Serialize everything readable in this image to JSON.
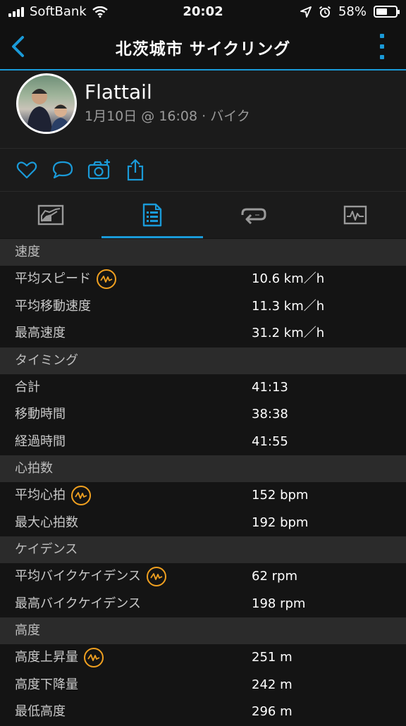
{
  "status_bar": {
    "carrier": "SoftBank",
    "time": "20:02",
    "battery": "58%",
    "battery_level": 0.58
  },
  "nav": {
    "title": "北茨城市 サイクリング"
  },
  "profile": {
    "name": "Flattail",
    "meta": "1月10日 @ 16:08 · バイク"
  },
  "colors": {
    "accent": "#1a9ad8",
    "badge": "#f0a020",
    "section_bg": "#2b2b2b",
    "row_bg": "#141414"
  },
  "tabs": [
    {
      "icon": "summary-chart-icon",
      "active": false
    },
    {
      "icon": "stats-list-icon",
      "active": true
    },
    {
      "icon": "laps-icon",
      "active": false
    },
    {
      "icon": "graph-icon",
      "active": false
    }
  ],
  "sections": {
    "speed": {
      "title": "速度",
      "rows": [
        {
          "label": "平均スピード",
          "value": "10.6 km／h",
          "badge": true
        },
        {
          "label": "平均移動速度",
          "value": "11.3 km／h",
          "badge": false
        },
        {
          "label": "最高速度",
          "value": "31.2 km／h",
          "badge": false
        }
      ]
    },
    "timing": {
      "title": "タイミング",
      "rows": [
        {
          "label": "合計",
          "value": "41:13",
          "badge": false
        },
        {
          "label": "移動時間",
          "value": "38:38",
          "badge": false
        },
        {
          "label": "経過時間",
          "value": "41:55",
          "badge": false
        }
      ]
    },
    "heart_rate": {
      "title": "心拍数",
      "rows": [
        {
          "label": "平均心拍",
          "value": "152 bpm",
          "badge": true
        },
        {
          "label": "最大心拍数",
          "value": "192 bpm",
          "badge": false
        }
      ]
    },
    "cadence": {
      "title": "ケイデンス",
      "rows": [
        {
          "label": "平均バイクケイデンス",
          "value": "62 rpm",
          "badge": true
        },
        {
          "label": "最高バイクケイデンス",
          "value": "198 rpm",
          "badge": false
        }
      ]
    },
    "elevation": {
      "title": "高度",
      "rows": [
        {
          "label": "高度上昇量",
          "value": "251 m",
          "badge": true
        },
        {
          "label": "高度下降量",
          "value": "242 m",
          "badge": false
        },
        {
          "label": "最低高度",
          "value": "296 m",
          "badge": false
        }
      ]
    }
  }
}
